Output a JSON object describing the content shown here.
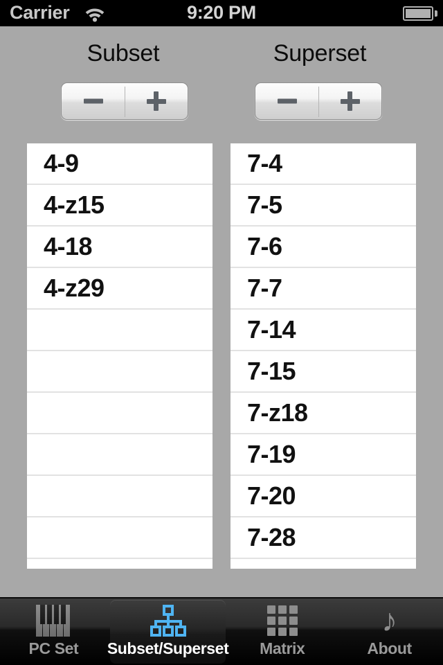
{
  "status_bar": {
    "carrier": "Carrier",
    "time": "9:20 PM",
    "wifi_icon": "wifi-icon",
    "battery_icon": "battery-icon"
  },
  "panels": {
    "subset": {
      "title": "Subset",
      "stepper": {
        "decrement_label": "−",
        "increment_label": "+"
      },
      "rows": [
        "4-9",
        "4-z15",
        "4-18",
        "4-z29",
        "",
        "",
        "",
        "",
        "",
        ""
      ]
    },
    "superset": {
      "title": "Superset",
      "stepper": {
        "decrement_label": "−",
        "increment_label": "+"
      },
      "rows": [
        "7-4",
        "7-5",
        "7-6",
        "7-7",
        "7-14",
        "7-15",
        "7-z18",
        "7-19",
        "7-20",
        "7-28"
      ]
    }
  },
  "tab_bar": {
    "selected_index": 1,
    "selected_color": "#ffffff",
    "unselected_color": "#9a9a9a",
    "accent_color": "#4fb4f2",
    "items": [
      {
        "label": "PC Set",
        "icon": "piano-icon"
      },
      {
        "label": "Subset/Superset",
        "icon": "hierarchy-icon"
      },
      {
        "label": "Matrix",
        "icon": "grid-icon"
      },
      {
        "label": "About",
        "icon": "music-note-icon"
      }
    ]
  },
  "colors": {
    "background": "#a8a8a8",
    "status_bar_background": "#000000",
    "table_background": "#ffffff",
    "separator": "#e2e2e2"
  },
  "icons": {
    "music_note_glyph": "♪"
  }
}
